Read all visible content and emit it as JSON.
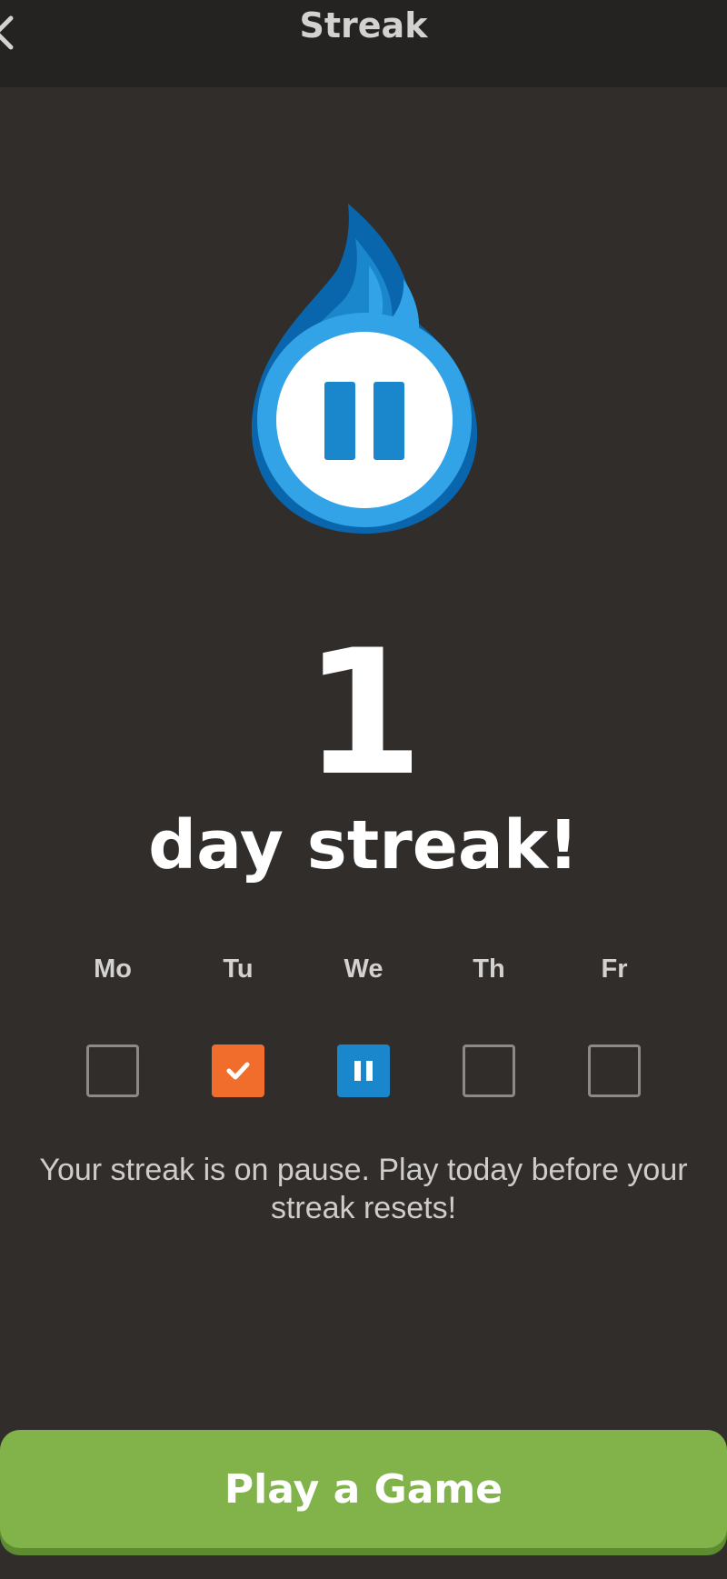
{
  "header": {
    "title": "Streak",
    "back_icon": "chevron-left-icon"
  },
  "hero": {
    "icon": "frozen-flame-pause-icon",
    "colors": {
      "flame_outer": "#0a66ac",
      "flame_inner": "#1a87cc",
      "flame_ring": "#31a3e6",
      "pause_bars": "#1a87cc"
    }
  },
  "streak": {
    "count": "1",
    "label": "day streak!"
  },
  "week": {
    "days": [
      {
        "label": "Mo",
        "status": "empty"
      },
      {
        "label": "Tu",
        "status": "done"
      },
      {
        "label": "We",
        "status": "frozen"
      },
      {
        "label": "Th",
        "status": "empty"
      },
      {
        "label": "Fr",
        "status": "empty"
      }
    ],
    "colors": {
      "done": "#f06d2c",
      "frozen": "#1a87cc",
      "empty_border": "#8c8987"
    }
  },
  "message": {
    "line1": "Your streak is on pause. Play today before your",
    "line2": "streak resets!"
  },
  "cta": {
    "label": "Play a Game",
    "color": "#82b34b"
  }
}
